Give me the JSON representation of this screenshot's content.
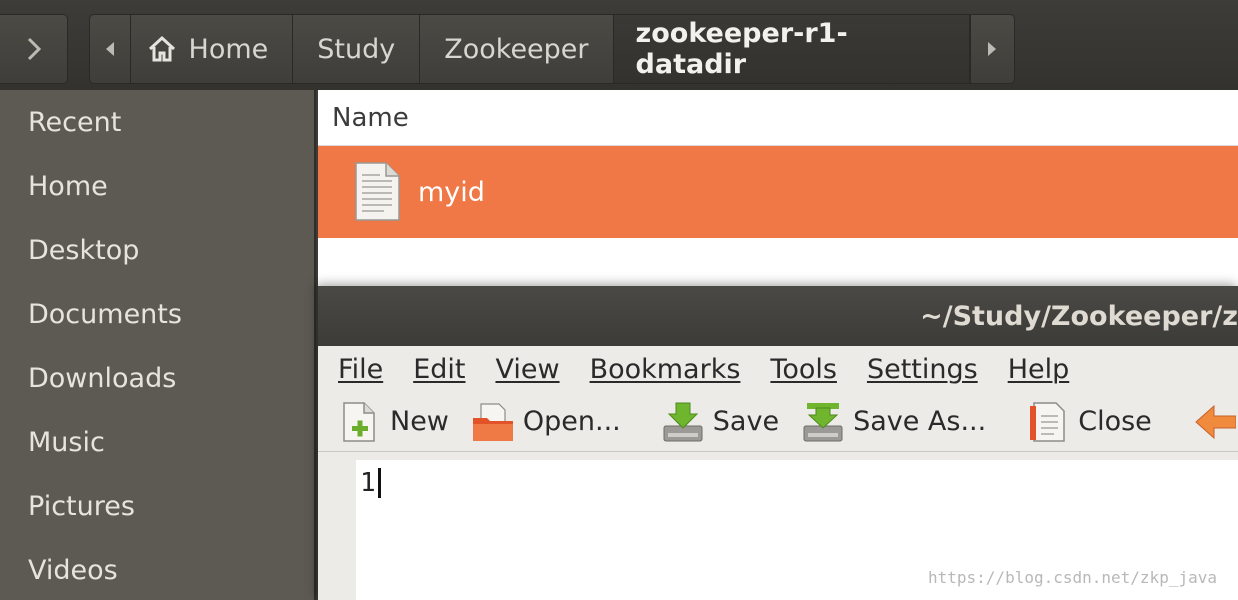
{
  "pathbar": {
    "crumbs": [
      "Home",
      "Study",
      "Zookeeper",
      "zookeeper-r1-datadir"
    ]
  },
  "sidebar": {
    "items": [
      "Recent",
      "Home",
      "Desktop",
      "Documents",
      "Downloads",
      "Music",
      "Pictures",
      "Videos"
    ]
  },
  "filelist": {
    "column_name": "Name",
    "files": [
      {
        "name": "myid",
        "icon": "text-file-icon"
      }
    ]
  },
  "editor": {
    "title": "~/Study/Zookeeper/z",
    "menu": [
      "File",
      "Edit",
      "View",
      "Bookmarks",
      "Tools",
      "Settings",
      "Help"
    ],
    "toolbar": {
      "new": "New",
      "open": "Open...",
      "save": "Save",
      "save_as": "Save As...",
      "close": "Close"
    },
    "content": "1"
  },
  "watermark": "https://blog.csdn.net/zkp_java",
  "colors": {
    "selection": "#f07746",
    "sidebar": "#5c5a52",
    "toolbar": "#3c3b37"
  }
}
